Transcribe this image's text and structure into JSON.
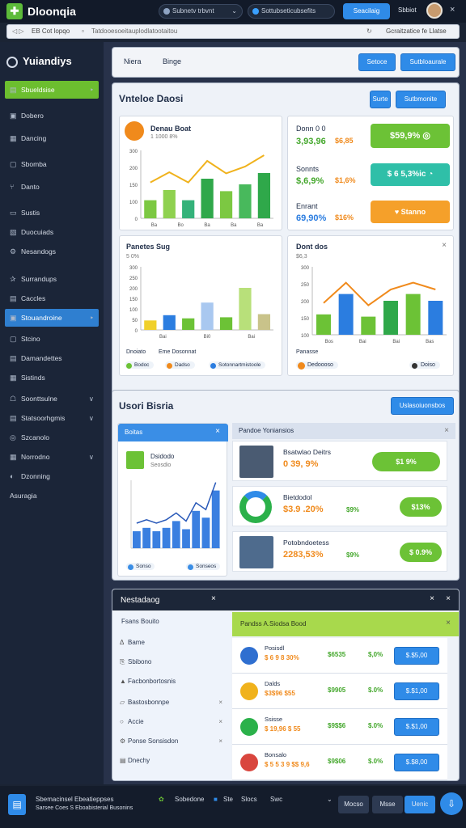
{
  "top": {
    "title": "Dloonqia",
    "tab1": "Subnetv trbvnt",
    "tab2": "Sottubseticubsefits",
    "btn": "Seacilaig",
    "user": "Sbbiot"
  },
  "url": {
    "left": "EB Cot lopqo",
    "text": "Tatdooesoeitauplodlatootaitou",
    "right": "Gcraitzatice fe Llatse"
  },
  "side": {
    "brand": "Yuiandiys",
    "items": [
      {
        "icon": "▤",
        "label": "Sbueldsise",
        "chev": "‣"
      },
      {
        "icon": "▣",
        "label": "Dobero"
      },
      {
        "icon": "▦",
        "label": "Dancing"
      },
      {
        "icon": "▢",
        "label": "Sbomba"
      },
      {
        "icon": "⑂",
        "label": "Danto"
      },
      {
        "icon": "▭",
        "label": "Sustis"
      },
      {
        "icon": "▧",
        "label": "Duocuiads"
      },
      {
        "icon": "⚙",
        "label": "Nesandogs"
      },
      {
        "icon": "✰",
        "label": "Surrandups"
      },
      {
        "icon": "▤",
        "label": "Caccles"
      },
      {
        "icon": "▣",
        "label": "Stouandroine",
        "chev": "‣"
      },
      {
        "icon": "▢",
        "label": "Stcino"
      },
      {
        "icon": "▤",
        "label": "Damandettes"
      },
      {
        "icon": "▦",
        "label": "Sistinds"
      },
      {
        "icon": "☖",
        "label": "Soonttsulne",
        "chev": "∨"
      },
      {
        "icon": "▤",
        "label": "Statsoorhgmis",
        "chev": "∨"
      },
      {
        "icon": "◎",
        "label": "Szcanolo"
      },
      {
        "icon": "▦",
        "label": "Norrodno",
        "chev": "∨"
      },
      {
        "icon": "◐",
        "label": "Dzonning"
      },
      {
        "label": "Asuragia"
      }
    ]
  },
  "header": {
    "tab1": "Niera",
    "tab2": "Binge",
    "btn1": "Setoce",
    "btn2": "Sutbloaurale"
  },
  "dash": {
    "title": "Vnteloe Daosi",
    "btn1": "Surte",
    "btn2": "Sutbmonite",
    "chart1": {
      "title": "Denau Boat",
      "sub": "1 1000 8%"
    },
    "stat1": {
      "name": "Donn 0 0",
      "v1": "3,93,96",
      "v2": "$6,85",
      "pill": "$59,9%"
    },
    "stat2": {
      "name": "Sonnts",
      "v1": "$,6,9%",
      "v2": "$1,6%",
      "pill": "$ 6 5,3%ic"
    },
    "stat3": {
      "name": "Enrant",
      "v1": "69,90%",
      "v2": "$16%",
      "pill": "Stanno"
    },
    "chart2": {
      "title": "Panetes Sug",
      "sub": "5 0%",
      "foot1": "Dnoiato",
      "foot2": "Eme Dosonnat",
      "leg1": "Bodoc",
      "leg2": "Dadso",
      "leg3": "Sotonnartmistoole"
    },
    "chart3": {
      "title": "Dont dos",
      "sub": "$6,3",
      "foot": "Panasse",
      "leg": "Dedoooso",
      "leg2": "Doiso"
    }
  },
  "chart_data": [
    {
      "type": "bar",
      "categories": [
        "Ba",
        "Bo",
        "Ba",
        "Ba",
        "Ba"
      ],
      "series": [
        {
          "values": [
            80,
            125,
            80,
            175,
            120,
            150,
            200
          ]
        }
      ],
      "ylim": [
        0,
        300
      ],
      "yticks": [
        "300",
        "200",
        "150",
        "100",
        "0"
      ]
    },
    {
      "type": "bar",
      "categories": [
        "Bai",
        "Bi0",
        "Bai"
      ],
      "series": [
        {
          "values": [
            45,
            70,
            55,
            130,
            60,
            200,
            75
          ]
        }
      ],
      "ylim": [
        0,
        300
      ],
      "yticks": [
        "300",
        "250",
        "200",
        "150",
        "100",
        "50",
        "0"
      ]
    },
    {
      "type": "bar",
      "categories": [
        "Bos",
        "Bai",
        "Bai",
        "Bas"
      ],
      "series": [
        {
          "values": [
            90,
            180,
            80,
            150,
            180,
            150
          ]
        }
      ],
      "ylim": [
        0,
        300
      ],
      "yticks": [
        "300",
        "250",
        "200",
        "150",
        "100"
      ]
    }
  ],
  "users": {
    "title": "Usori Bisria",
    "btn": "Uslasoiuonsbos",
    "card": {
      "title": "Boitas",
      "name": "Dsidodo",
      "sub": "Seosdio",
      "leg1": "Sonso",
      "leg2": "Sonseos"
    },
    "panelTitle": "Pandoe Yoniansios",
    "rows": [
      {
        "name": "Bsatwlao Deitrs",
        "val": "0 39, 9%",
        "pill": "$1 9%"
      },
      {
        "name": "Bietdodol",
        "val": "$3.9 .20%",
        "val2": "$9%",
        "pill": "$13%"
      },
      {
        "name": "Potobndoetess",
        "val": "2283,53%",
        "val2": "$9%",
        "pill": "$ 0.9%"
      }
    ]
  },
  "notes": {
    "title": "Nestadaog",
    "items": [
      {
        "icon": "❀",
        "label": "Fsans Bouito"
      },
      {
        "icon": "Δ",
        "label": "Bame"
      },
      {
        "icon": "⎘",
        "label": "Sbibono"
      },
      {
        "icon": "▲",
        "label": "Facbonbortosnis"
      },
      {
        "icon": "▱",
        "label": "Bastosbonnpe",
        "x": "×"
      },
      {
        "icon": "○",
        "label": "Accie",
        "x": "×"
      },
      {
        "icon": "⚙",
        "label": "Ponse Sonsisdon",
        "x": "×"
      },
      {
        "icon": "▤",
        "label": "Dnechy"
      }
    ],
    "rightTitle": "Pandss A.Siodsa Bood",
    "rows": [
      {
        "name": "Posisdl",
        "sub": "$ 6 9 8 30%",
        "v1": "$6535",
        "v2": "$,0%",
        "btn": "$.$5,00"
      },
      {
        "name": "Dalds",
        "sub": "$3$96 $55",
        "v1": "$9905",
        "v2": "$.0%",
        "btn": "$.$1,00"
      },
      {
        "name": "Ssisse",
        "sub": "$ 19,96 $ 55",
        "v1": "$9$$6",
        "v2": "$.0%",
        "btn": "$.$1,00"
      },
      {
        "name": "Bonsalo",
        "sub": "$ 5 5 3 9 $$ 9,6",
        "v1": "$9$06",
        "v2": "$.0%",
        "btn": "$.$8,00"
      }
    ]
  },
  "bottom": {
    "l1": "Sbemacinsel Ebeatieppses",
    "l2": "Sarsee Coes S Eboabisterial Busonins",
    "a": "Sobedone",
    "b": "Ste",
    "c": "Slocs",
    "d": "Swc",
    "btn1": "Mocso",
    "btn2": "Msse",
    "btn3": "Uenic"
  },
  "colors": {
    "green": "#6cbe2f",
    "blue": "#2f8be8",
    "orange": "#f08a1c",
    "navy": "#1b2538"
  }
}
